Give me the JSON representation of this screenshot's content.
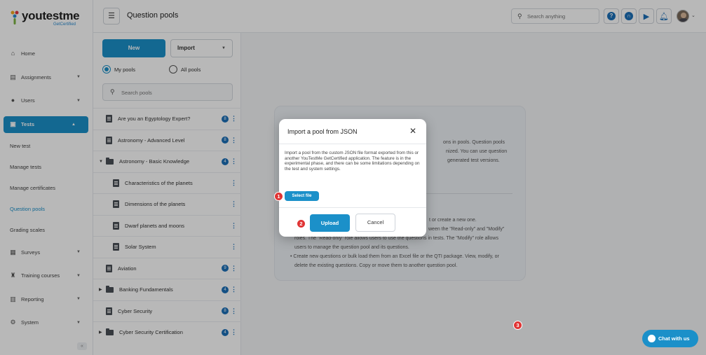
{
  "brand": {
    "name": "youtestme",
    "tagline": "GetCertified"
  },
  "header": {
    "title": "Question pools",
    "search_placeholder": "Search anything"
  },
  "sidebar": {
    "items": [
      {
        "label": "Home",
        "icon": "home-icon"
      },
      {
        "label": "Assignments",
        "icon": "assignments-icon"
      },
      {
        "label": "Users",
        "icon": "users-icon"
      },
      {
        "label": "Tests",
        "icon": "tests-icon"
      },
      {
        "label": "New test"
      },
      {
        "label": "Manage tests"
      },
      {
        "label": "Manage certificates"
      },
      {
        "label": "Question pools"
      },
      {
        "label": "Grading scales"
      },
      {
        "label": "Surveys",
        "icon": "surveys-icon"
      },
      {
        "label": "Training courses",
        "icon": "trophy-icon"
      },
      {
        "label": "Reporting",
        "icon": "reporting-icon"
      },
      {
        "label": "System",
        "icon": "gear-icon"
      }
    ],
    "collapse_label": "«"
  },
  "pools": {
    "new_label": "New",
    "import_label": "Import",
    "radio_my": "My pools",
    "radio_all": "All pools",
    "search_placeholder": "Search pools",
    "rows": [
      {
        "label": "Are you an Egyptology Expert?",
        "badge": "8"
      },
      {
        "label": "Astronomy - Advanced Level",
        "badge": "8"
      },
      {
        "label": "Astronomy - Basic Knowledge",
        "badge": "4"
      },
      {
        "label": "Characteristics of the planets"
      },
      {
        "label": "Dimensions of the planets"
      },
      {
        "label": "Dwarf planets and moons"
      },
      {
        "label": "Solar System"
      },
      {
        "label": "Aviation",
        "badge": "9"
      },
      {
        "label": "Banking Fundamentals",
        "badge": "4"
      },
      {
        "label": "Cyber Security",
        "badge": "8"
      },
      {
        "label": "Cyber Security Certification",
        "badge": "4"
      }
    ]
  },
  "info": {
    "lines": [
      "ons in pools. Question pools",
      "nized. You can use question",
      "generated test versions.",
      "t or create a new one.",
      "ween the \"Read-only\" and \"Modify\"",
      "roles. The \"Read-only\" role allows users to use the questions in tests. The \"Modify\" role allows",
      "users to manage the question pool and its questions.",
      "• Create new questions or bulk load them from an Excel file or the QTI package. View, modify, or",
      "delete the existing questions. Copy or move them to another question pool."
    ]
  },
  "modal": {
    "title": "Import a pool from JSON",
    "close": "✕",
    "body": "Import a pool from the custom JSON file format exported from this or another YouTestMe GetCertified application. The feature is in the experimental phase, and there can be some limitations depending on the test and system settings.",
    "select_file": "Select file",
    "upload": "Upload",
    "cancel": "Cancel"
  },
  "steps": [
    "1",
    "2",
    "3"
  ],
  "chat": {
    "label": "Chat with us"
  },
  "colors": {
    "accent": "#1b90c9",
    "step": "#e03434"
  }
}
